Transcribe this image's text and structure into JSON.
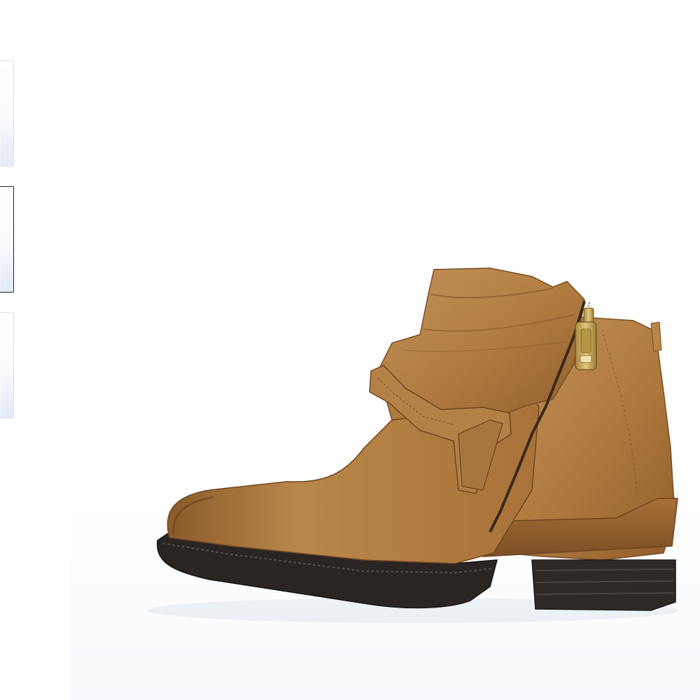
{
  "gallery": {
    "thumbnails": [
      {
        "name": "thumbnail-1",
        "selected": false
      },
      {
        "name": "thumbnail-2",
        "selected": true
      },
      {
        "name": "thumbnail-3",
        "selected": false
      }
    ],
    "main_image": {
      "subject": "boot-icon",
      "colors": {
        "leather": "#b07a3e",
        "leather_dark": "#8a5a2b",
        "leather_light": "#c99a5e",
        "sole": "#2a2523",
        "zipper": "#c9a85c"
      }
    }
  }
}
